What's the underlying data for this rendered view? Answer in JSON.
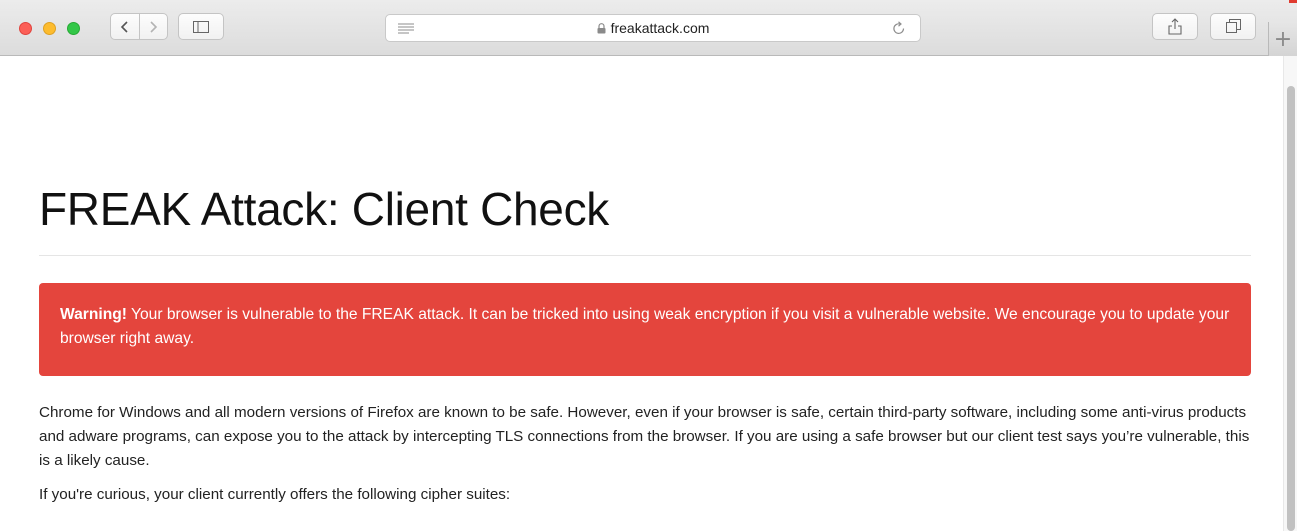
{
  "browser": {
    "url": "freakattack.com",
    "icons": {
      "back": "chevron-left-icon",
      "forward": "chevron-right-icon",
      "sidebar": "sidebar-icon",
      "reader": "reader-icon",
      "lock": "lock-icon",
      "reload": "reload-icon",
      "share": "share-icon",
      "tabs": "tabs-icon",
      "new_tab": "plus-icon"
    },
    "new_tab_glyph": "+"
  },
  "page": {
    "title": "FREAK Attack: Client Check",
    "alert": {
      "label": "Warning!",
      "message": " Your browser is vulnerable to the FREAK attack. It can be tricked into using weak encryption if you visit a vulnerable website. We encourage you to update your browser right away.",
      "background": "#e4453d"
    },
    "paragraphs": [
      "Chrome for Windows and all modern versions of Firefox are known to be safe. However, even if your browser is safe, certain third-party software, including some anti-virus products and adware programs, can expose you to the attack by intercepting TLS connections from the browser. If you are using a safe browser but our client test says you’re vulnerable, this is a likely cause.",
      "If you're curious, your client currently offers the following cipher suites:"
    ]
  }
}
